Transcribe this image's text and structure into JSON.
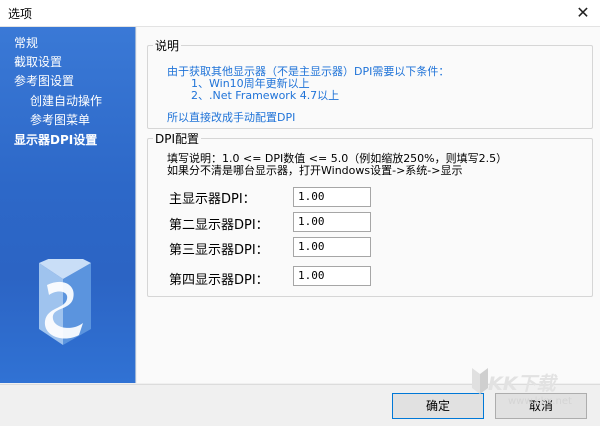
{
  "window": {
    "title": "选项",
    "close_glyph": "✕"
  },
  "sidebar": {
    "items": [
      {
        "label": "常规"
      },
      {
        "label": "截取设置"
      },
      {
        "label": "参考图设置"
      },
      {
        "label": "创建自动操作"
      },
      {
        "label": "参考图菜单"
      },
      {
        "label": "显示器DPI设置"
      }
    ],
    "active_index": 5,
    "logo_icon": "app-logo-icon"
  },
  "notice": {
    "legend": "说明",
    "line1": "由于获取其他显示器（不是主显示器）DPI需要以下条件：",
    "line2": "1、Win10周年更新以上",
    "line3": "2、.Net Framework 4.7以上",
    "line4": "所以直接改成手动配置DPI"
  },
  "dpi": {
    "legend": "DPI配置",
    "note1": "填写说明：1.0 <= DPI数值 <= 5.0（例如缩放250%，则填写2.5）",
    "note2": "如果分不清是哪台显示器，打开Windows设置->系统->显示",
    "rows": [
      {
        "label": "主显示器DPI：",
        "value": "1.00"
      },
      {
        "label": "第二显示器DPI：",
        "value": "1.00"
      },
      {
        "label": "第三显示器DPI：",
        "value": "1.00"
      },
      {
        "label": "第四显示器DPI：",
        "value": "1.00"
      }
    ]
  },
  "buttons": {
    "ok": "确定",
    "cancel": "取消"
  },
  "watermark": {
    "text": "KK下载",
    "url": "www.kkx.net"
  },
  "colors": {
    "sidebar": "#2d68c8",
    "info_text": "#1f73d8",
    "ok_border": "#0078d7"
  }
}
